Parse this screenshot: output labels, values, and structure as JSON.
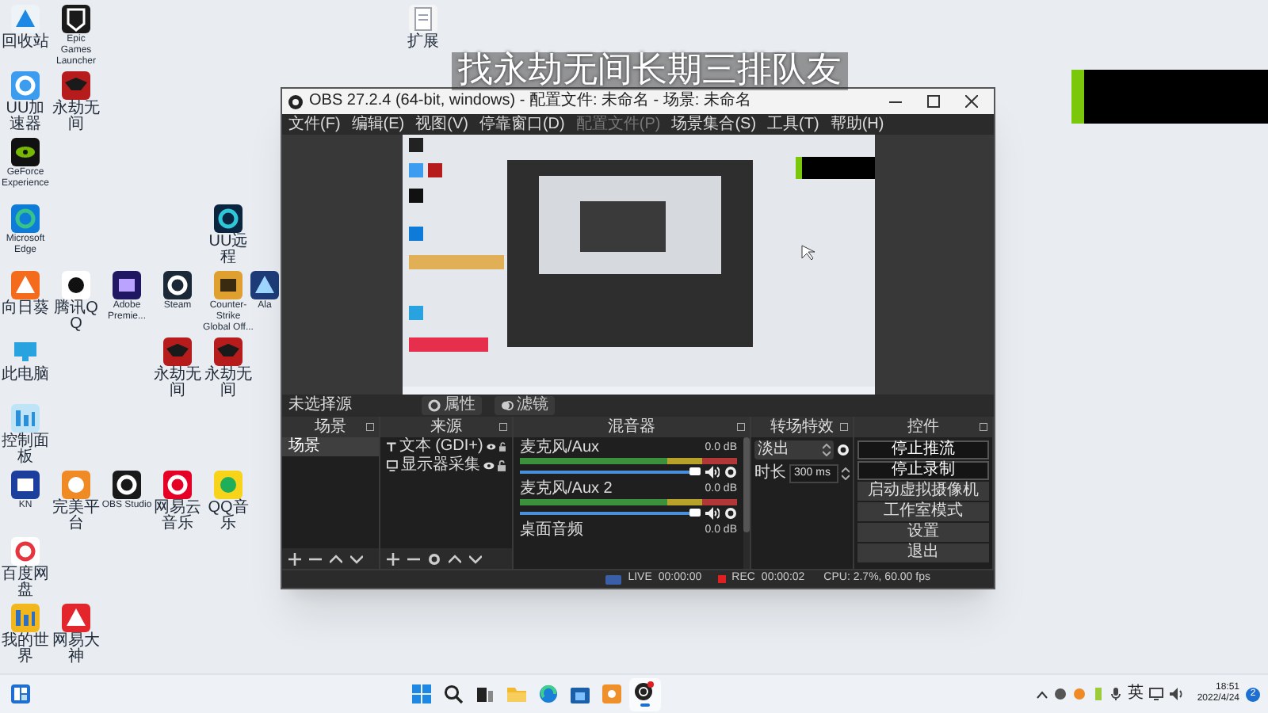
{
  "overlay_text": "找永劫无间长期三排队友",
  "desktop_icons": [
    {
      "label": "回收站"
    },
    {
      "label": "Epic Games Launcher"
    },
    {
      "label": "扩展"
    },
    {
      "label": "UU加速器"
    },
    {
      "label": "永劫无间"
    },
    {
      "label": "GeForce Experience"
    },
    {
      "label": "Microsoft Edge"
    },
    {
      "label": "UU远程"
    },
    {
      "label": "向日葵"
    },
    {
      "label": "腾讯QQ"
    },
    {
      "label": "Adobe Premie..."
    },
    {
      "label": "Steam"
    },
    {
      "label": "Counter-Strike Global Off..."
    },
    {
      "label": "Ala"
    },
    {
      "label": "此电脑"
    },
    {
      "label": "永劫无间"
    },
    {
      "label": "永劫无间"
    },
    {
      "label": "控制面板"
    },
    {
      "label": "KN"
    },
    {
      "label": "完美平台"
    },
    {
      "label": "OBS Studio"
    },
    {
      "label": "网易云音乐"
    },
    {
      "label": "QQ音乐"
    },
    {
      "label": "百度网盘"
    },
    {
      "label": "我的世界"
    },
    {
      "label": "网易大神"
    }
  ],
  "window": {
    "title": "OBS 27.2.4 (64-bit, windows) - 配置文件: 未命名 - 场景: 未命名",
    "menu": [
      {
        "label": "文件(F)",
        "disabled": false
      },
      {
        "label": "编辑(E)",
        "disabled": false
      },
      {
        "label": "视图(V)",
        "disabled": false
      },
      {
        "label": "停靠窗口(D)",
        "disabled": false
      },
      {
        "label": "配置文件(P)",
        "disabled": true
      },
      {
        "label": "场景集合(S)",
        "disabled": false
      },
      {
        "label": "工具(T)",
        "disabled": false
      },
      {
        "label": "帮助(H)",
        "disabled": false
      }
    ],
    "source_bar": {
      "label": "未选择源",
      "buttons": [
        "属性",
        "滤镜"
      ]
    },
    "docks": {
      "scenes": {
        "title": "场景",
        "items": [
          {
            "name": "场景",
            "selected": true
          }
        ]
      },
      "sources": {
        "title": "来源",
        "items": [
          {
            "name": "文本 (GDI+)",
            "kind": "text",
            "visible": true
          },
          {
            "name": "显示器采集",
            "kind": "display",
            "visible": true
          }
        ]
      },
      "mixer": {
        "title": "混音器",
        "channels": [
          {
            "name": "麦克风/Aux",
            "reading": "0.0 dB",
            "muted": false
          },
          {
            "name": "麦克风/Aux 2",
            "reading": "0.0 dB",
            "muted": false
          },
          {
            "name": "桌面音频",
            "reading": "0.0 dB"
          }
        ]
      },
      "transitions": {
        "title": "转场特效",
        "transition": "淡出",
        "duration_label": "时长",
        "duration": "300 ms"
      },
      "controls": {
        "title": "控件",
        "buttons": [
          {
            "label": "停止推流",
            "active": true
          },
          {
            "label": "停止录制",
            "active": true
          },
          {
            "label": "启动虚拟摄像机",
            "active": false
          },
          {
            "label": "工作室模式",
            "active": false
          },
          {
            "label": "设置",
            "active": false
          },
          {
            "label": "退出",
            "active": false
          }
        ]
      }
    },
    "status_bar": {
      "live_label": "LIVE",
      "live_time": "00:00:00",
      "rec_label": "REC",
      "rec_time": "00:00:02",
      "cpu": "CPU: 2.7%, 60.00 fps"
    }
  },
  "taskbar": {
    "apps": [
      {
        "selected": false
      },
      {
        "selected": false
      },
      {
        "selected": false
      },
      {
        "selected": false
      },
      {
        "selected": false
      },
      {
        "selected": false
      },
      {
        "selected": false
      },
      {
        "selected": true
      }
    ],
    "input_method": "英",
    "time": "18:51",
    "date": "2022/4/24",
    "notifications": "2"
  }
}
